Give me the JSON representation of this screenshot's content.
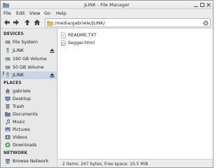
{
  "window": {
    "title": "JLINK - File Manager"
  },
  "menubar": {
    "items": [
      "File",
      "Edit",
      "View",
      "Go",
      "Help"
    ]
  },
  "toolbar": {
    "location_path": "/media/gabriele/JLINK/"
  },
  "sidebar": {
    "devices_header": "DEVICES",
    "devices": [
      {
        "label": "File System",
        "icon": "drive-icon"
      },
      {
        "label": "JLINK",
        "icon": "usb-drive-icon",
        "ejectable": true
      },
      {
        "label": "190 GB Volume",
        "icon": "drive-icon"
      },
      {
        "label": "50 GB Volume",
        "icon": "drive-icon"
      },
      {
        "label": "JLINK",
        "icon": "usb-drive-icon",
        "ejectable": true,
        "selected": true
      }
    ],
    "places_header": "PLACES",
    "places": [
      {
        "label": "gabriele",
        "icon": "home-icon"
      },
      {
        "label": "Desktop",
        "icon": "desktop-icon"
      },
      {
        "label": "Trash",
        "icon": "trash-icon"
      },
      {
        "label": "Documents",
        "icon": "folder-icon"
      },
      {
        "label": "Music",
        "icon": "music-icon"
      },
      {
        "label": "Pictures",
        "icon": "pictures-icon"
      },
      {
        "label": "Videos",
        "icon": "videos-icon"
      },
      {
        "label": "Downloads",
        "icon": "downloads-icon"
      }
    ],
    "network_header": "NETWORK",
    "network": [
      {
        "label": "Browse Network",
        "icon": "network-icon"
      }
    ]
  },
  "files": [
    {
      "name": "README.TXT",
      "icon": "text-file-icon"
    },
    {
      "name": "Segger.html",
      "icon": "html-file-icon"
    }
  ],
  "statusbar": {
    "text": "2 items: 247 bytes, Free space: 10,5 MiB"
  },
  "colors": {
    "selection": "#c9d6e6",
    "sidebar_bg": "#e8e8e8",
    "toolbar_bg": "#ececec"
  }
}
